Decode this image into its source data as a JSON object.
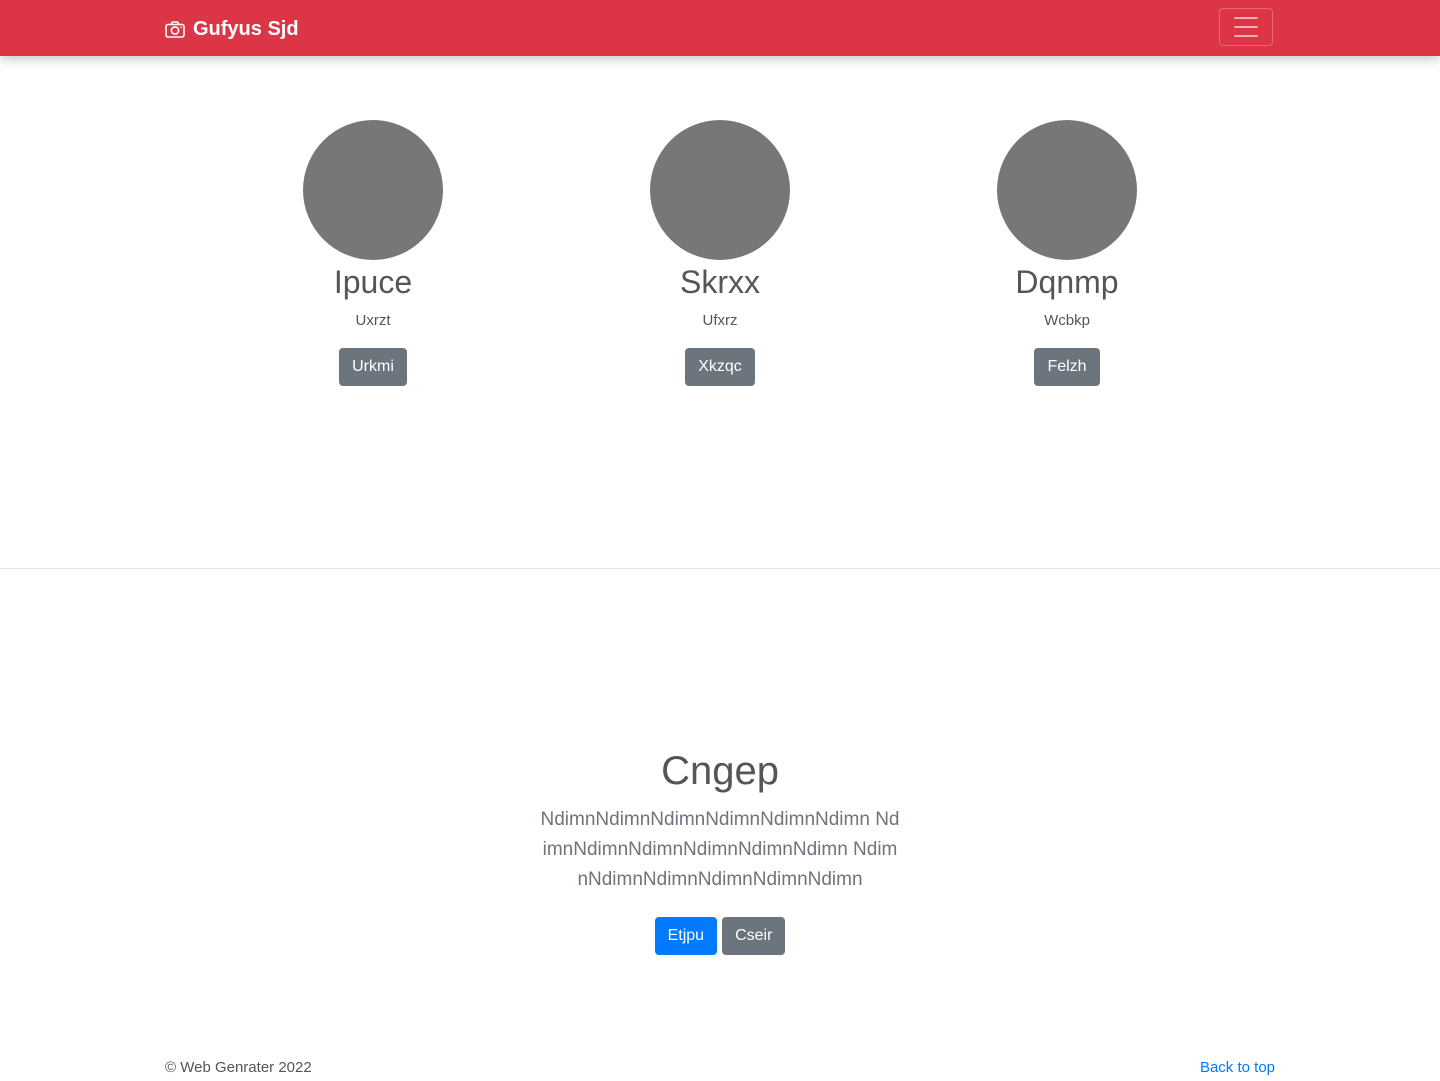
{
  "navbar": {
    "brand": "Gufyus Sjd",
    "brand_icon": "camera-icon",
    "toggler_icon": "hamburger-icon",
    "color": "#dc3545"
  },
  "people": [
    {
      "name": "Ipuce",
      "desc": "Uxrzt",
      "button": "Urkmi"
    },
    {
      "name": "Skrxx",
      "desc": "Ufxrz",
      "button": "Xkzqc"
    },
    {
      "name": "Dqnmp",
      "desc": "Wcbkp",
      "button": "Felzh"
    }
  ],
  "hero": {
    "title": "Cngep",
    "text": "NdimnNdimnNdimnNdimnNdimnNdimn NdimnNdimnNdimnNdimnNdimnNdimn NdimnNdimnNdimnNdimnNdimnNdimn",
    "primary_button": "Etjpu",
    "secondary_button": "Cseir"
  },
  "footer": {
    "copyright": "© Web Genrater 2022",
    "back_to_top": "Back to top"
  }
}
